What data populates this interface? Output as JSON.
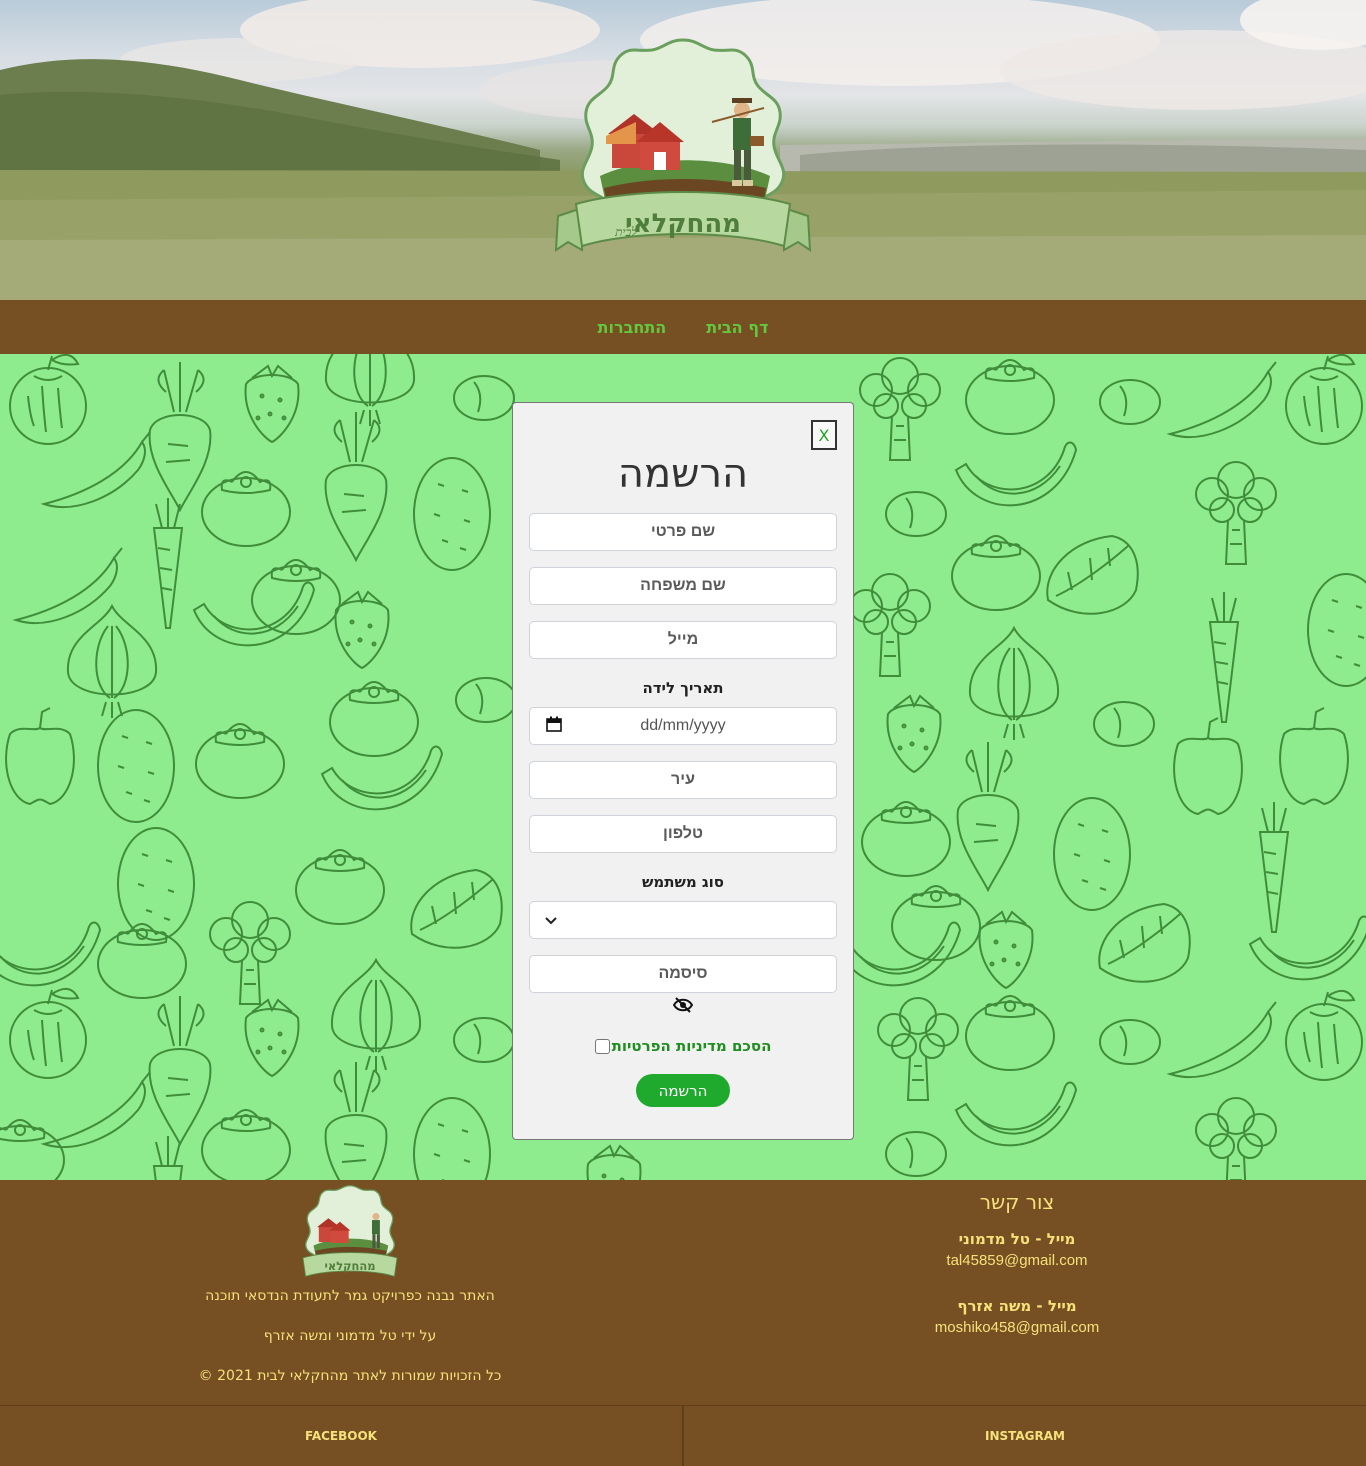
{
  "logo": {
    "text": "מהחקלאי",
    "subtext": "לבית"
  },
  "nav": {
    "home": "דף הבית",
    "login": "התחברות"
  },
  "modal": {
    "close": "X",
    "title": "הרשמה",
    "first_name_placeholder": "שם פרטי",
    "last_name_placeholder": "שם משפחה",
    "email_placeholder": "מייל",
    "birthdate_label": "תאריך לידה",
    "birthdate_placeholder": "dd/mm/yyyy",
    "city_placeholder": "עיר",
    "phone_placeholder": "טלפון",
    "user_type_label": "סוג משתמש",
    "user_type_value": "",
    "password_placeholder": "סיסמה",
    "agree_label": "הסכם מדיניות הפרטיות",
    "submit": "הרשמה"
  },
  "footer": {
    "contact_title": "צור קשר",
    "contact1_name": "מייל - טל מדמוני",
    "contact1_email": "tal45859@gmail.com",
    "contact2_name": "מייל - משה אזרף",
    "contact2_email": "moshiko458@gmail.com",
    "about_line1": "האתר נבנה כפרויקט גמר לתעודת הנדסאי תוכנה",
    "about_line2": "על ידי טל מדמוני ומשה אזרף",
    "about_line3": "כל הזכויות שמורות לאתר מהחקלאי לבית  2021  ©",
    "facebook": "FACEBOOK",
    "instagram": "INSTAGRAM"
  },
  "colors": {
    "brown": "#764f23",
    "green_bg": "#8fec8e",
    "accent_green": "#1faa2e",
    "footer_text": "#f5e27a"
  }
}
